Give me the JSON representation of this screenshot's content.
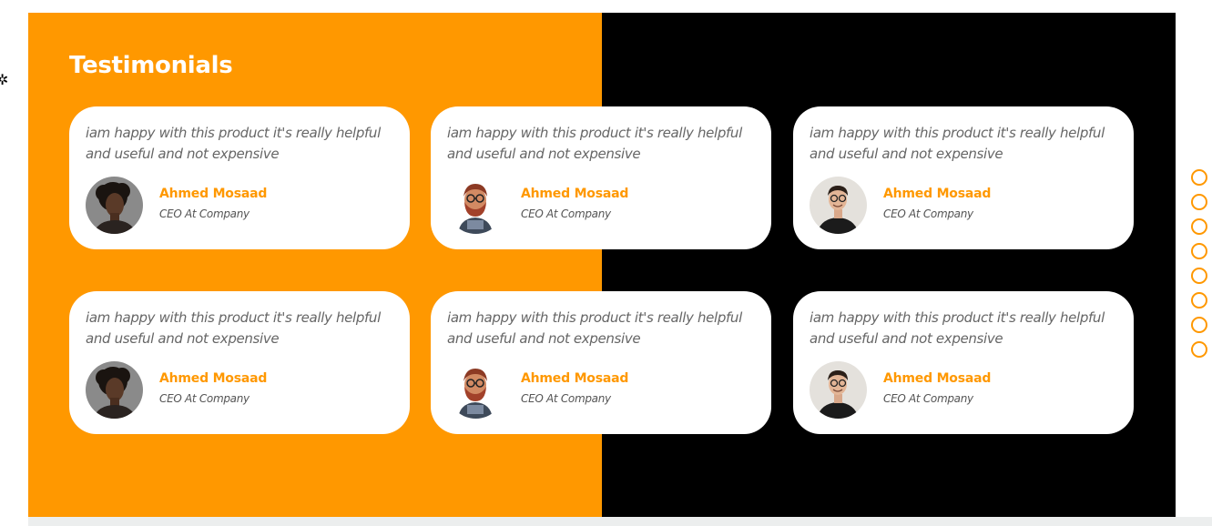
{
  "section": {
    "title": "Testimonials",
    "colors": {
      "left_bg": "#ff9800",
      "right_bg": "#000000",
      "card_bg": "#ffffff",
      "accent": "#ff9800"
    }
  },
  "testimonials": [
    {
      "quote": "iam happy with this product it's really helpful and useful and not expensive",
      "name": "Ahmed Mosaad",
      "role": "CEO At Company",
      "avatar": "woman-photo-avatar"
    },
    {
      "quote": "iam happy with this product it's really helpful and useful and not expensive",
      "name": "Ahmed Mosaad",
      "role": "CEO At Company",
      "avatar": "bearded-man-illustration-avatar"
    },
    {
      "quote": "iam happy with this product it's really helpful and useful and not expensive",
      "name": "Ahmed Mosaad",
      "role": "CEO At Company",
      "avatar": "man-glasses-photo-avatar"
    },
    {
      "quote": "iam happy with this product it's really helpful and useful and not expensive",
      "name": "Ahmed Mosaad",
      "role": "CEO At Company",
      "avatar": "woman-photo-avatar"
    },
    {
      "quote": "iam happy with this product it's really helpful and useful and not expensive",
      "name": "Ahmed Mosaad",
      "role": "CEO At Company",
      "avatar": "bearded-man-illustration-avatar"
    },
    {
      "quote": "iam happy with this product it's really helpful and useful and not expensive",
      "name": "Ahmed Mosaad",
      "role": "CEO At Company",
      "avatar": "man-glasses-photo-avatar"
    }
  ],
  "side_nav": {
    "dot_count": 8,
    "icon": "circle-outline-icon"
  },
  "settings_icon": "gear-icon"
}
